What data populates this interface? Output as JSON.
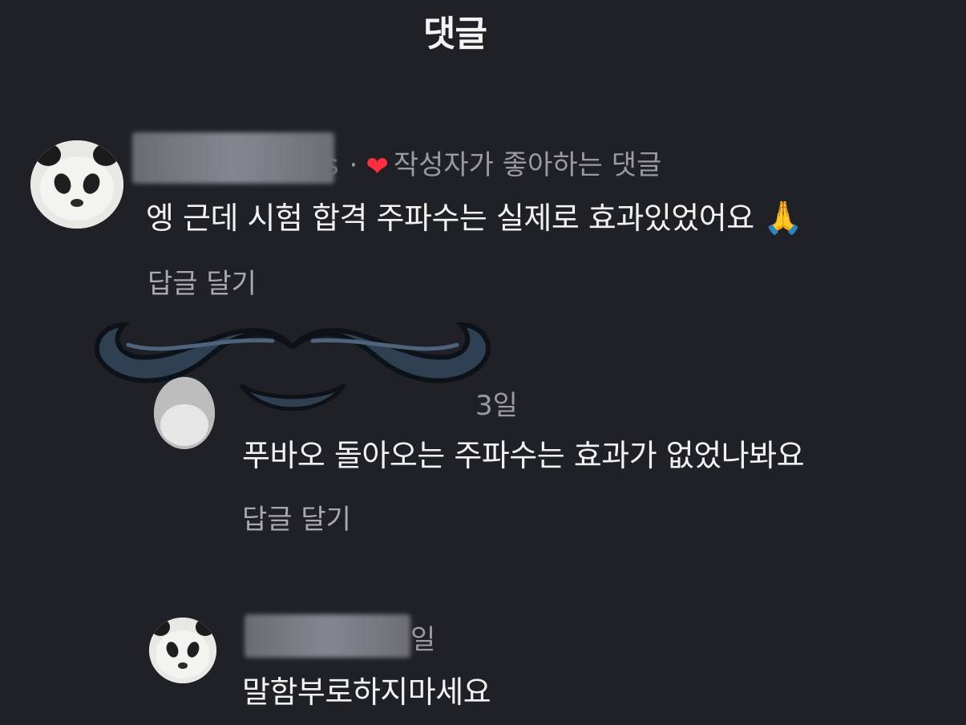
{
  "header": {
    "title": "댓글"
  },
  "comments": [
    {
      "author_suffix": "s",
      "meta_separator": "·",
      "liked_by_author_label": "작성자가 좋아하는 댓글",
      "text": "엥 근데 시험 합격 주파수는 실제로 효과있었어요",
      "emoji": "🙏",
      "reply_label": "답글 달기"
    },
    {
      "timestamp": "3일",
      "text": "푸바오 돌아오는 주파수는 효과가 없었나봐요",
      "reply_label": "답글 달기"
    },
    {
      "timestamp": "일",
      "text": "말함부로하지마세요"
    }
  ],
  "icons": {
    "heart": "heart-icon",
    "pray": "pray-emoji",
    "overlay": "mustache-overlay"
  },
  "colors": {
    "background": "#202127",
    "heart": "#ff2f3e",
    "mustache": "#2f4052"
  }
}
